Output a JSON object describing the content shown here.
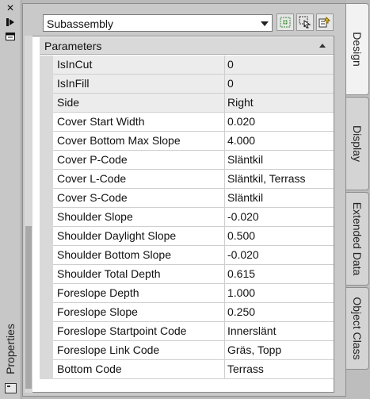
{
  "window": {
    "title": "Properties",
    "close_glyph": "✕"
  },
  "toolbar": {
    "object_type": "Subassembly",
    "buttons": [
      "quick-select-icon",
      "select-objects-icon",
      "toggle-pickadd-icon"
    ]
  },
  "category": {
    "label": "Parameters"
  },
  "rows": [
    {
      "name": "IsInCut",
      "value": "0",
      "readonly": true
    },
    {
      "name": "IsInFill",
      "value": "0",
      "readonly": true
    },
    {
      "name": "Side",
      "value": "Right",
      "readonly": true
    },
    {
      "name": "Cover Start Width",
      "value": "0.020",
      "readonly": false
    },
    {
      "name": "Cover Bottom Max Slope",
      "value": "4.000",
      "readonly": false
    },
    {
      "name": "Cover P-Code",
      "value": "Släntkil",
      "readonly": false
    },
    {
      "name": "Cover L-Code",
      "value": "Släntkil, Terrass",
      "readonly": false
    },
    {
      "name": "Cover S-Code",
      "value": "Släntkil",
      "readonly": false
    },
    {
      "name": "Shoulder Slope",
      "value": "-0.020",
      "readonly": false
    },
    {
      "name": "Shoulder Daylight Slope",
      "value": "0.500",
      "readonly": false
    },
    {
      "name": "Shoulder Bottom Slope",
      "value": "-0.020",
      "readonly": false
    },
    {
      "name": "Shoulder Total Depth",
      "value": "0.615",
      "readonly": false
    },
    {
      "name": "Foreslope Depth",
      "value": "1.000",
      "readonly": false
    },
    {
      "name": "Foreslope Slope",
      "value": "0.250",
      "readonly": false
    },
    {
      "name": "Foreslope Startpoint Code",
      "value": "Innerslänt",
      "readonly": false
    },
    {
      "name": "Foreslope Link Code",
      "value": "Gräs, Topp",
      "readonly": false
    },
    {
      "name": "Bottom Code",
      "value": "Terrass",
      "readonly": false
    }
  ],
  "tabs": [
    {
      "label": "Design",
      "active": true
    },
    {
      "label": "Display",
      "active": false
    },
    {
      "label": "Extended Data",
      "active": false
    },
    {
      "label": "Object Class",
      "active": false
    }
  ]
}
